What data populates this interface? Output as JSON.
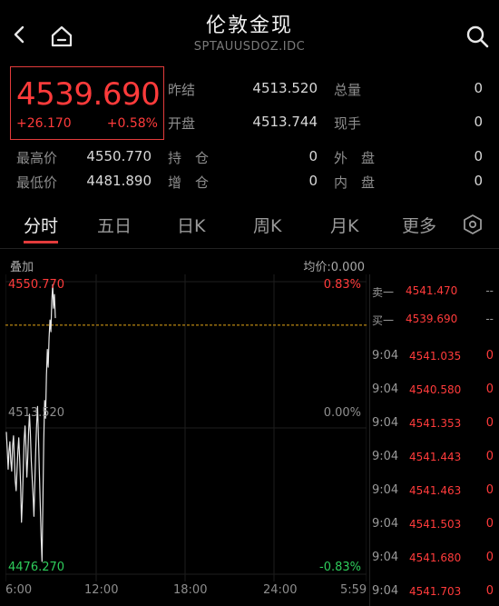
{
  "header": {
    "title": "伦敦金现",
    "subtitle": "SPTAUUSDOZ.IDC"
  },
  "quote": {
    "price": "4539.690",
    "change": "+26.170",
    "change_pct": "+0.58%",
    "up_color": "#ff3b3b",
    "down_color": "#2ecc5b"
  },
  "stats": [
    {
      "label": "昨结",
      "value": "4513.520"
    },
    {
      "label": "总量",
      "value": "0"
    },
    {
      "label": "开盘",
      "value": "4513.744"
    },
    {
      "label": "现手",
      "value": "0"
    },
    {
      "label": "最高价",
      "value": "4550.770"
    },
    {
      "label": "持　仓",
      "value": "0"
    },
    {
      "label": "外　盘",
      "value": "0"
    },
    {
      "label": "最低价",
      "value": "4481.890"
    },
    {
      "label": "增　仓",
      "value": "0"
    },
    {
      "label": "内　盘",
      "value": "0"
    }
  ],
  "tabs": [
    "分时",
    "五日",
    "日K",
    "周K",
    "月K",
    "更多"
  ],
  "chart_header": {
    "overlay_label": "叠加",
    "avg_label": "均价:0.000"
  },
  "chart_data": {
    "type": "line",
    "y_labels": {
      "top": "4550.770",
      "mid": "4513.520",
      "bottom": "4476.270"
    },
    "pct_labels": {
      "top": "0.83%",
      "mid": "0.00%",
      "bottom": "-0.83%"
    },
    "x_labels": [
      "6:00",
      "12:00",
      "18:00",
      "24:00",
      "5:59"
    ],
    "ylim": [
      4476.27,
      4550.77
    ],
    "reference": 4513.52,
    "last_price": 4539.69,
    "x": [
      0,
      1,
      2,
      3,
      4,
      5,
      6,
      7,
      8,
      9,
      10,
      11,
      12,
      13,
      14,
      15,
      16,
      17,
      18,
      19,
      20,
      21,
      22,
      23,
      24,
      25,
      26,
      27,
      28,
      29,
      30,
      31,
      32,
      33,
      34,
      35,
      36,
      37,
      38,
      39,
      40,
      41,
      42,
      43,
      44,
      45,
      46,
      47,
      48,
      49,
      50,
      51,
      52,
      53,
      54,
      55
    ],
    "values": [
      4512.5,
      4508.0,
      4503.0,
      4507.5,
      4510.0,
      4505.0,
      4502.5,
      4509.0,
      4511.5,
      4506.0,
      4500.0,
      4497.5,
      4503.0,
      4508.0,
      4511.0,
      4505.5,
      4499.0,
      4489.5,
      4495.0,
      4503.5,
      4510.5,
      4514.0,
      4508.5,
      4501.0,
      4506.0,
      4512.5,
      4517.0,
      4512.0,
      4505.0,
      4500.5,
      4496.0,
      4491.0,
      4499.5,
      4508.0,
      4514.5,
      4519.0,
      4512.0,
      4503.0,
      4494.5,
      4486.0,
      4479.5,
      4495.0,
      4510.0,
      4520.5,
      4516.0,
      4527.0,
      4533.5,
      4529.0,
      4536.5,
      4541.0,
      4538.0,
      4546.0,
      4550.0,
      4544.0,
      4547.5,
      4541.5
    ]
  },
  "orderbook": {
    "ask": {
      "label": "卖一",
      "price": "4541.470",
      "qty": "--"
    },
    "bid": {
      "label": "买一",
      "price": "4539.690",
      "qty": "--"
    }
  },
  "ticks": [
    {
      "time": "9:04",
      "price": "4541.035",
      "vol": "0"
    },
    {
      "time": "9:04",
      "price": "4540.580",
      "vol": "0"
    },
    {
      "time": "9:04",
      "price": "4541.353",
      "vol": "0"
    },
    {
      "time": "9:04",
      "price": "4541.443",
      "vol": "0"
    },
    {
      "time": "9:04",
      "price": "4541.463",
      "vol": "0"
    },
    {
      "time": "9:04",
      "price": "4541.503",
      "vol": "0"
    },
    {
      "time": "9:04",
      "price": "4541.680",
      "vol": "0"
    },
    {
      "time": "9:04",
      "price": "4541.703",
      "vol": "0"
    }
  ]
}
